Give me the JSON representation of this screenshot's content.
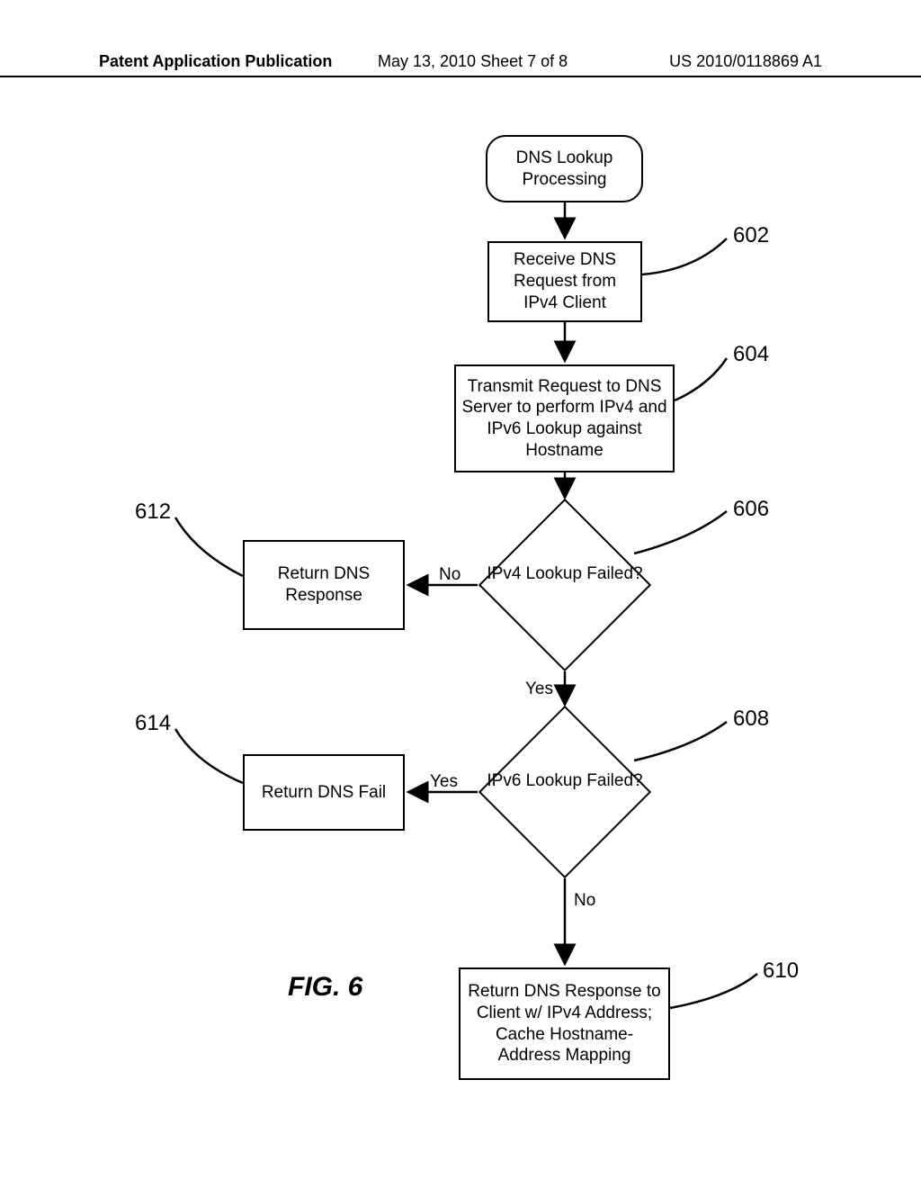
{
  "header": {
    "left": "Patent Application Publication",
    "mid": "May 13, 2010  Sheet 7 of 8",
    "right": "US 2010/0118869 A1"
  },
  "figure_label": "FIG. 6",
  "nodes": {
    "start": "DNS Lookup Processing",
    "n602": "Receive DNS Request from IPv4 Client",
    "n604": "Transmit Request to DNS Server to perform IPv4 and IPv6 Lookup against Hostname",
    "d606": "IPv4 Lookup Failed?",
    "d608": "IPv6 Lookup Failed?",
    "n610": "Return DNS Response to Client w/ IPv4 Address; Cache Hostname-Address Mapping",
    "n612": "Return DNS Response",
    "n614": "Return DNS Fail"
  },
  "edges": {
    "d606_no": "No",
    "d606_yes": "Yes",
    "d608_yes": "Yes",
    "d608_no": "No"
  },
  "refs": {
    "r602": "602",
    "r604": "604",
    "r606": "606",
    "r608": "608",
    "r610": "610",
    "r612": "612",
    "r614": "614"
  }
}
